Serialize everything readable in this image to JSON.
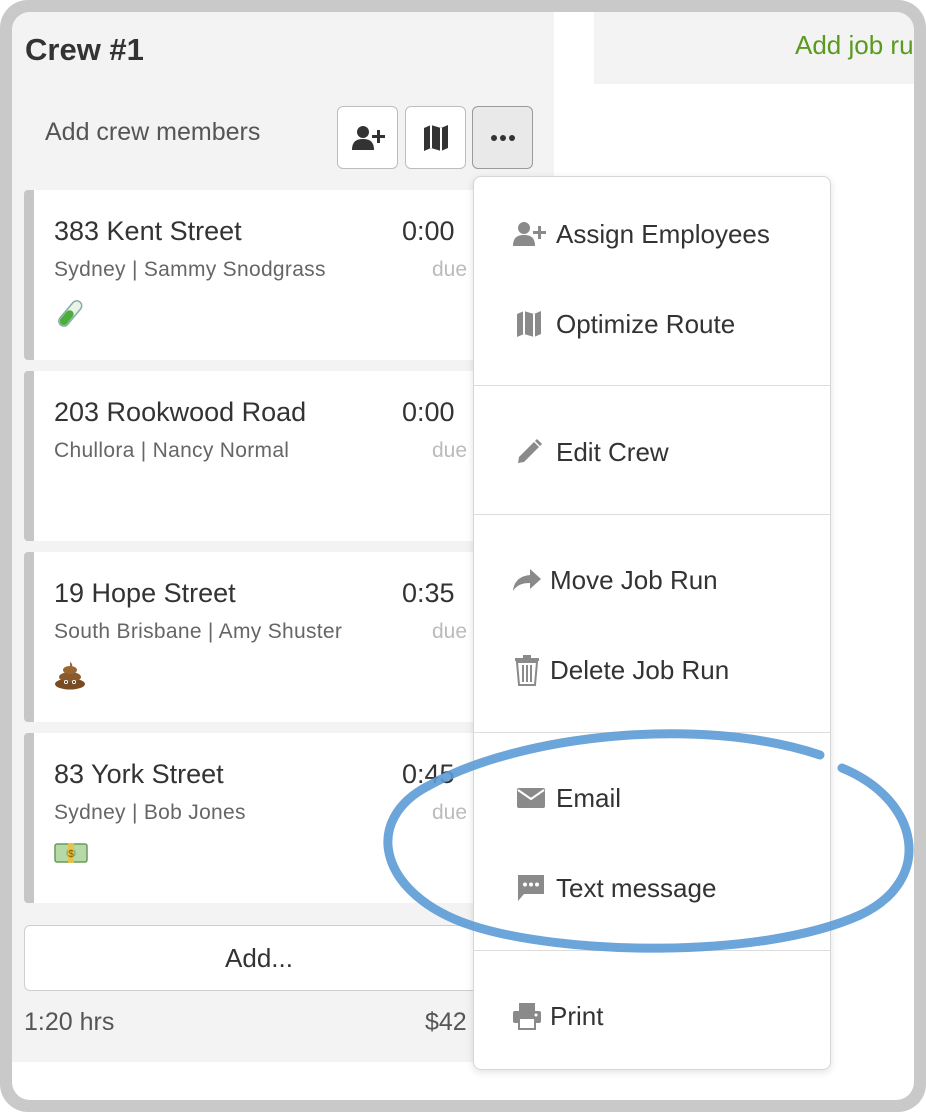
{
  "crew": {
    "title": "Crew #1",
    "add_members_label": "Add crew members"
  },
  "toolbar": {
    "assign_icon": "user-plus-icon",
    "map_icon": "map-icon",
    "more_icon": "ellipsis-icon"
  },
  "header": {
    "add_job_run_label": "Add job ru"
  },
  "jobs": [
    {
      "address": "383 Kent Street",
      "time": "0:00",
      "detail": "Sydney | Sammy Snodgrass",
      "due": "due",
      "emoji": "🧪"
    },
    {
      "address": "203 Rookwood Road",
      "time": "0:00",
      "detail": "Chullora | Nancy Normal",
      "due": "due",
      "emoji": ""
    },
    {
      "address": "19 Hope Street",
      "time": "0:35",
      "detail": "South Brisbane | Amy Shuster",
      "due": "due",
      "emoji": "💩"
    },
    {
      "address": "83 York Street",
      "time": "0:45",
      "detail": "Sydney | Bob Jones",
      "due": "due",
      "emoji": "💵"
    }
  ],
  "add_button_label": "Add...",
  "footer": {
    "hours": "1:20 hrs",
    "cost": "$42"
  },
  "menu": {
    "assign_employees": "Assign Employees",
    "optimize_route": "Optimize Route",
    "edit_crew": "Edit Crew",
    "move_job_run": "Move Job Run",
    "delete_job_run": "Delete Job Run",
    "email": "Email",
    "text_message": "Text message",
    "print": "Print"
  },
  "colors": {
    "accent_green": "#5a9a1e",
    "highlight_circle": "#5b9bd5",
    "icon_gray": "#8a8a8a"
  }
}
